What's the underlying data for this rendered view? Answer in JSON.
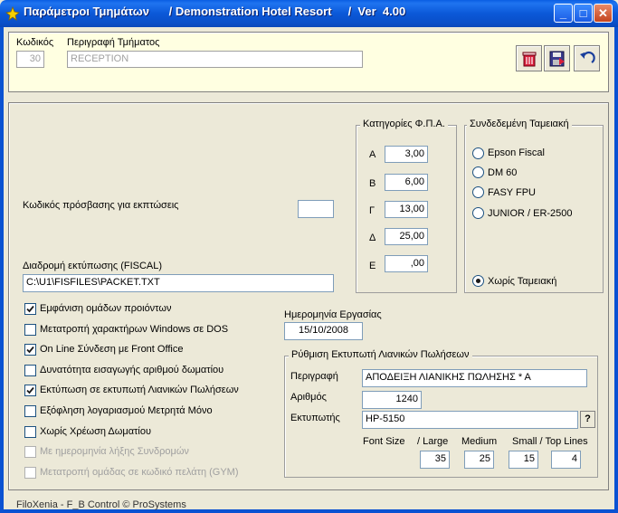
{
  "window": {
    "title": "Παράμετροι Τμημάτων      / Demonstration Hotel Resort     /  Ver  4.00",
    "minimize": "_",
    "maximize": "□",
    "close": "✕"
  },
  "header": {
    "code_label": "Κωδικός",
    "code_value": "30",
    "desc_label": "Περιγραφή Τμήματος",
    "desc_value": "RECEPTION",
    "buttons": [
      "delete-icon",
      "save-icon",
      "undo-icon"
    ]
  },
  "main": {
    "discount_password_label": "Κωδικός πρόσβασης για εκπτώσεις",
    "discount_password_value": "",
    "fiscal_path_label": "Διαδρομή εκτύπωσης (FISCAL)",
    "fiscal_path_value": "C:\\U1\\FISFILES\\PACKET.TXT",
    "vat": {
      "title": "Κατηγορίες Φ.Π.Α.",
      "rows": [
        {
          "label": "Α",
          "value": "3,00"
        },
        {
          "label": "Β",
          "value": "6,00"
        },
        {
          "label": "Γ",
          "value": "13,00"
        },
        {
          "label": "Δ",
          "value": "25,00"
        },
        {
          "label": "Ε",
          "value": ",00"
        }
      ]
    },
    "register": {
      "title": "Συνδεδεμένη Ταμειακή",
      "options": [
        "Epson Fiscal",
        "DM 60",
        "FASY FPU",
        "JUNIOR / ER-2500"
      ],
      "none_option": "Χωρίς Ταμειακή",
      "selected": "Χωρίς Ταμειακή"
    },
    "checkboxes": [
      {
        "label": "Εμφάνιση ομάδων προιόντων",
        "checked": true,
        "enabled": true
      },
      {
        "label": "Μετατροπή χαρακτήρων Windows σε DOS",
        "checked": false,
        "enabled": true
      },
      {
        "label": "On Line Σύνδεση με Front Office",
        "checked": true,
        "enabled": true
      },
      {
        "label": "Δυνατότητα εισαγωγής αριθμού δωματίου",
        "checked": false,
        "enabled": true
      },
      {
        "label": "Εκτύπωση σε εκτυπωτή Λιανικών Πωλήσεων",
        "checked": true,
        "enabled": true
      },
      {
        "label": "Εξόφληση λογαριασμού Μετρητά Μόνο",
        "checked": false,
        "enabled": true
      },
      {
        "label": "Χωρίς Χρέωση Δωματίου",
        "checked": false,
        "enabled": true
      },
      {
        "label": "Με ημερομηνία λήξης Συνδρομών",
        "checked": false,
        "enabled": false
      },
      {
        "label": "Μετατροπή ομάδας σε κωδικό πελάτη (GYM)",
        "checked": false,
        "enabled": false
      }
    ],
    "work_date_label": "Ημερομηνία Εργασίας",
    "work_date_value": "15/10/2008",
    "retail_printer": {
      "title": "Ρύθμιση Εκτυπωτή Λιανικών Πωλήσεων",
      "desc_label": "Περιγραφή",
      "desc_value": "ΑΠΟΔΕΙΞΗ ΛΙΑΝΙΚΗΣ ΠΩΛΗΣΗΣ * Α",
      "number_label": "Αριθμός",
      "number_value": "1240",
      "printer_label": "Εκτυπωτής",
      "printer_value": "HP-5150",
      "help_button": "?",
      "font_size_label": "Font Size",
      "large_label": "/ Large",
      "medium_label": "Medium",
      "small_label": "Small / Top Lines",
      "font_size_value": "35",
      "medium_value": "25",
      "small_value": "15",
      "top_lines_value": "4"
    }
  },
  "footer": {
    "text": "FiloXenia - F_B Control  © ProSystems"
  }
}
